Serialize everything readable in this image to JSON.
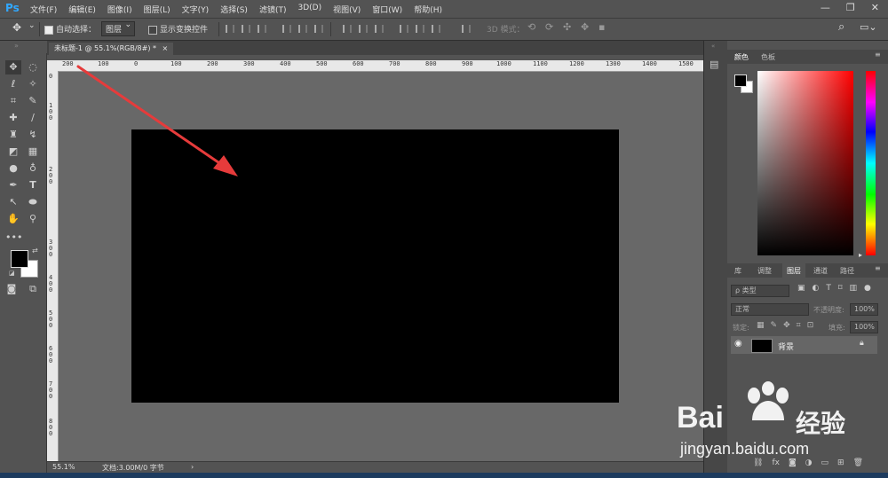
{
  "app": {
    "logo": "Ps"
  },
  "menu": [
    "文件(F)",
    "编辑(E)",
    "图像(I)",
    "图层(L)",
    "文字(Y)",
    "选择(S)",
    "滤镜(T)",
    "3D(D)",
    "视图(V)",
    "窗口(W)",
    "帮助(H)"
  ],
  "window_controls": {
    "minimize": "—",
    "restore": "❐",
    "close": "✕"
  },
  "options_bar": {
    "auto_select_label": "自动选择：",
    "auto_select_value": "图层",
    "show_transform_label": "显示变换控件",
    "mode_3d_label": "3D 模式："
  },
  "document": {
    "tab_title": "未标题-1 @ 55.1%(RGB/8#) *",
    "tab_close": "×",
    "canvas_color": "#000000"
  },
  "ruler": {
    "top_labels": [
      "200",
      "100",
      "0",
      "100",
      "200",
      "300",
      "400",
      "500",
      "600",
      "700",
      "800",
      "900",
      "1000",
      "1100",
      "1200",
      "1300",
      "1400",
      "1500"
    ],
    "left_labels": [
      "0",
      "1 0 0",
      "2 0 0",
      "3 0 0",
      "4 0 0",
      "5 0 0",
      "6 0 0",
      "7 0 0",
      "8 0 0"
    ]
  },
  "status": {
    "zoom": "55.1%",
    "doc_info": "文档:3.00M/0 字节",
    "arrow": "›"
  },
  "color_panel": {
    "tabs": [
      "颜色",
      "色板"
    ],
    "foreground": "#000000",
    "background": "#ffffff"
  },
  "layers_panel": {
    "tabs": [
      "库",
      "调整",
      "图层",
      "通道",
      "路径"
    ],
    "active_tab": "图层",
    "filter_kind": "ρ 类型",
    "blend_mode": "正常",
    "opacity_label": "不透明度:",
    "opacity_value": "100%",
    "lock_label": "锁定:",
    "fill_label": "填充:",
    "fill_value": "100%",
    "layers": [
      {
        "name": "背景",
        "visible": true,
        "locked": true
      }
    ],
    "bottom_icons": [
      "link-icon",
      "fx-icon",
      "mask-icon",
      "adjustment-icon",
      "group-icon",
      "new-layer-icon",
      "trash-icon"
    ]
  },
  "watermark": {
    "brand_latin": "Bai",
    "brand_cjk": "经验",
    "url": "jingyan.baidu.com"
  },
  "colors": {
    "accent_arrow": "#e63b3b",
    "ps_blue": "#31a8ff"
  }
}
